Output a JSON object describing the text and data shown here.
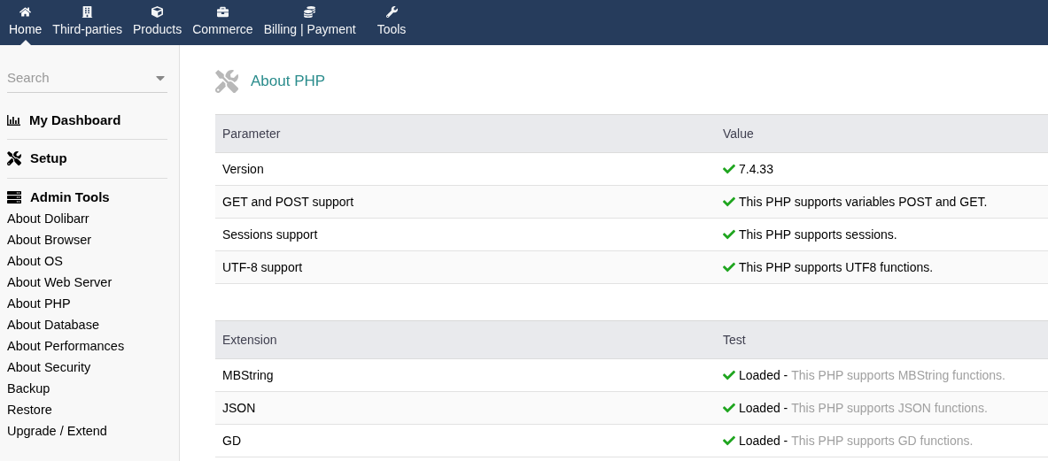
{
  "topnav": [
    {
      "label": "Home",
      "kind": "home",
      "selected": true
    },
    {
      "label": "Third-parties",
      "kind": "building",
      "selected": false
    },
    {
      "label": "Products",
      "kind": "cube",
      "selected": false
    },
    {
      "label": "Commerce",
      "kind": "briefcase",
      "selected": false
    },
    {
      "label": "Billing | Payment",
      "kind": "coins",
      "selected": false
    },
    {
      "label": "Tools",
      "kind": "wrench",
      "selected": false
    }
  ],
  "sidebar": {
    "search": {
      "placeholder": "Search"
    },
    "sections": [
      {
        "label": "My Dashboard",
        "kind": "chart"
      },
      {
        "label": "Setup",
        "kind": "tools"
      },
      {
        "label": "Admin Tools",
        "kind": "server",
        "items": [
          {
            "label": "About Dolibarr",
            "selected": false
          },
          {
            "label": "About Browser",
            "selected": false
          },
          {
            "label": "About OS",
            "selected": false
          },
          {
            "label": "About Web Server",
            "selected": false
          },
          {
            "label": "About PHP",
            "selected": false
          },
          {
            "label": "About Database",
            "selected": false
          },
          {
            "label": "About Performances",
            "selected": false
          },
          {
            "label": "About Security",
            "selected": false
          },
          {
            "label": "Backup",
            "selected": false
          },
          {
            "label": "Restore",
            "selected": false
          },
          {
            "label": "Upgrade / Extend",
            "selected": false
          }
        ]
      }
    ]
  },
  "page": {
    "title": "About PHP",
    "parameters": {
      "columns": [
        "Parameter",
        "Value"
      ],
      "rows": [
        {
          "name": "Version",
          "ok": true,
          "value": "7.4.33"
        },
        {
          "name": "GET and POST support",
          "ok": true,
          "value": "This PHP supports variables POST and GET."
        },
        {
          "name": "Sessions support",
          "ok": true,
          "value": "This PHP supports sessions."
        },
        {
          "name": "UTF-8 support",
          "ok": true,
          "value": "This PHP supports UTF8 functions."
        }
      ]
    },
    "extensions": {
      "columns": [
        "Extension",
        "Test"
      ],
      "rows": [
        {
          "name": "MBString",
          "ok": true,
          "status": "Loaded -",
          "note": "This PHP supports MBString functions."
        },
        {
          "name": "JSON",
          "ok": true,
          "status": "Loaded -",
          "note": "This PHP supports JSON functions."
        },
        {
          "name": "GD",
          "ok": true,
          "status": "Loaded -",
          "note": "This PHP supports GD functions."
        }
      ]
    }
  }
}
